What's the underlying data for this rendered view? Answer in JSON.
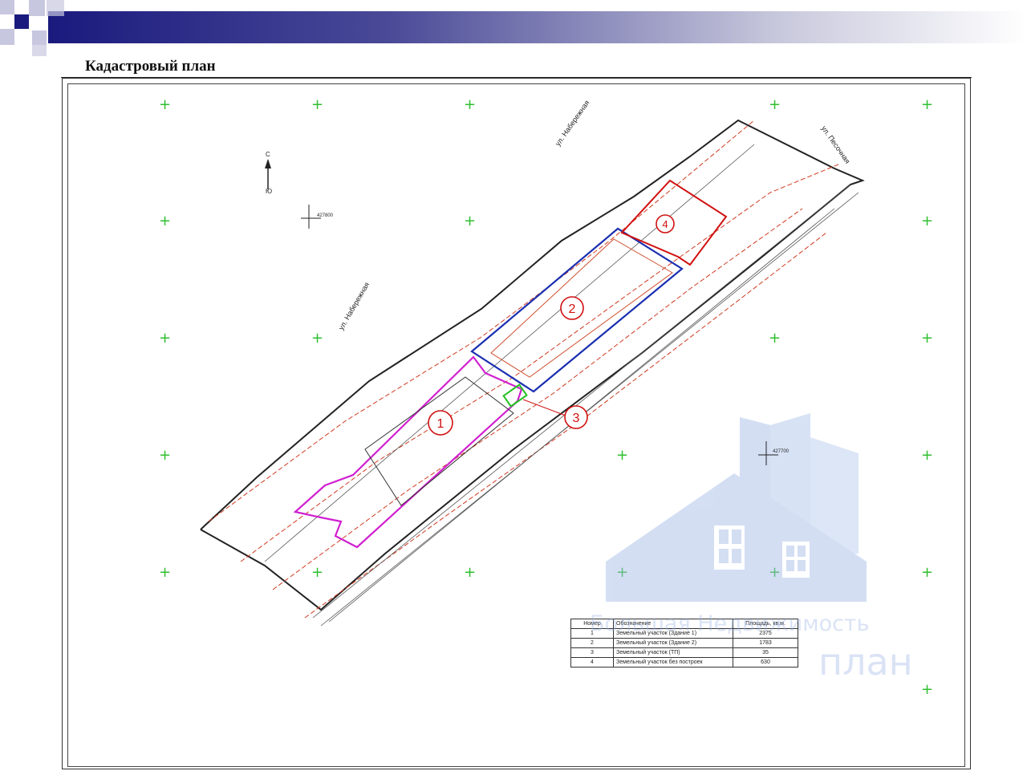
{
  "page_title": "Кадастровый план",
  "streets": {
    "top_right": "ул. Песочная",
    "top": "ул. Набережная",
    "left": "ул. Набережная"
  },
  "compass": {
    "north": "С",
    "south": "Ю"
  },
  "coords": {
    "left": "427800",
    "right": "427700"
  },
  "parcels": [
    {
      "num": "1",
      "color": "#d01010"
    },
    {
      "num": "2",
      "color": "#d01010"
    },
    {
      "num": "3",
      "color": "#d01010"
    },
    {
      "num": "4",
      "color": "#d01010"
    }
  ],
  "legend": {
    "headers": [
      "Номер",
      "Обозначение",
      "Площадь, кв.м."
    ],
    "rows": [
      {
        "num": "1",
        "name": "Земельный участок (Здание 1)",
        "area": "2375"
      },
      {
        "num": "2",
        "name": "Земельный участок (Здание 2)",
        "area": "1783"
      },
      {
        "num": "3",
        "name": "Земельный участок (ТП)",
        "area": "35"
      },
      {
        "num": "4",
        "name": "Земельный участок без построек",
        "area": "630"
      }
    ]
  },
  "watermark": {
    "line1": "Большая Недвижимость",
    "line2": "план"
  },
  "colors": {
    "header_blue": "#1a1a7e",
    "cross_green": "#2fbf2f",
    "parcel_red": "#d01010",
    "parcel_blue": "#1a2fb0",
    "parcel_magenta": "#d020d0"
  }
}
